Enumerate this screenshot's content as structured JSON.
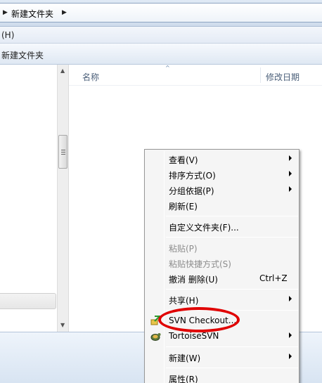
{
  "address_bar": {
    "current_folder": "新建文件夹"
  },
  "menu_bar": {
    "visible_item": "(H)"
  },
  "toolbar": {
    "folder_title": "新建文件夹"
  },
  "file_list": {
    "columns": [
      {
        "label": "名称"
      },
      {
        "label": "修改日期"
      }
    ]
  },
  "context_menu": {
    "view": "查看(V)",
    "sort_by": "排序方式(O)",
    "group_by": "分组依据(P)",
    "refresh": "刷新(E)",
    "customize_folder": "自定义文件夹(F)...",
    "paste": "粘贴(P)",
    "paste_shortcut": "粘贴快捷方式(S)",
    "undo_delete": "撤消 删除(U)",
    "undo_shortcut": "Ctrl+Z",
    "share": "共享(H)",
    "svn_checkout": "SVN Checkout...",
    "tortoise_svn": "TortoiseSVN",
    "new": "新建(W)",
    "properties": "属性(R)"
  },
  "colors": {
    "highlight_oval": "#e00000",
    "menu_background": "#f5f5f5"
  },
  "icons": {
    "svn_checkout": "svn-checkout-icon",
    "tortoise_svn": "tortoise-svn-icon"
  }
}
